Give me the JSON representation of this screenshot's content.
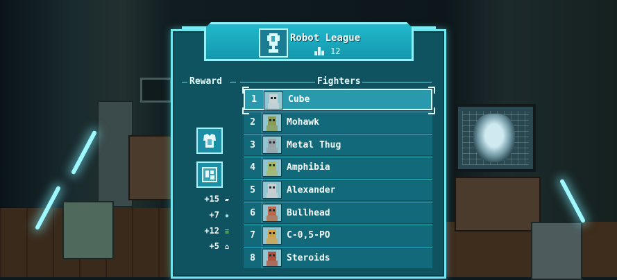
{
  "league": {
    "title": "Robot League",
    "fans": "12",
    "trophy_icon": "trophy-icon",
    "fans_icon": "fans-icon"
  },
  "sections": {
    "reward": "Reward",
    "fighters": "Fighters"
  },
  "rewards": {
    "items": [
      {
        "icon": "armor-icon"
      },
      {
        "icon": "blueprint-icon"
      }
    ],
    "lines": [
      {
        "value": "+15",
        "icon": "parts-icon"
      },
      {
        "value": "+7",
        "icon": "gear-icon"
      },
      {
        "value": "+12",
        "icon": "cash-icon"
      },
      {
        "value": "+5",
        "icon": "crate-icon"
      }
    ]
  },
  "fighters": [
    {
      "rank": "1",
      "name": "Cube",
      "avatar": "cube-robot",
      "color": "#c9d3d6",
      "selected": true
    },
    {
      "rank": "2",
      "name": "Mohawk",
      "avatar": "mohawk-robot",
      "color": "#8a9b54"
    },
    {
      "rank": "3",
      "name": "Metal Thug",
      "avatar": "metal-thug-robot",
      "color": "#9aa3a8"
    },
    {
      "rank": "4",
      "name": "Amphibia",
      "avatar": "amphibia-robot",
      "color": "#a8b66a"
    },
    {
      "rank": "5",
      "name": "Alexander",
      "avatar": "alexander-robot",
      "color": "#c9cfd2"
    },
    {
      "rank": "6",
      "name": "Bullhead",
      "avatar": "bullhead-robot",
      "color": "#b86a4a"
    },
    {
      "rank": "7",
      "name": "C-0,5-PO",
      "avatar": "c-05-po-robot",
      "color": "#d2a24a"
    },
    {
      "rank": "8",
      "name": "Steroids",
      "avatar": "steroids-robot",
      "color": "#b0553d"
    }
  ]
}
